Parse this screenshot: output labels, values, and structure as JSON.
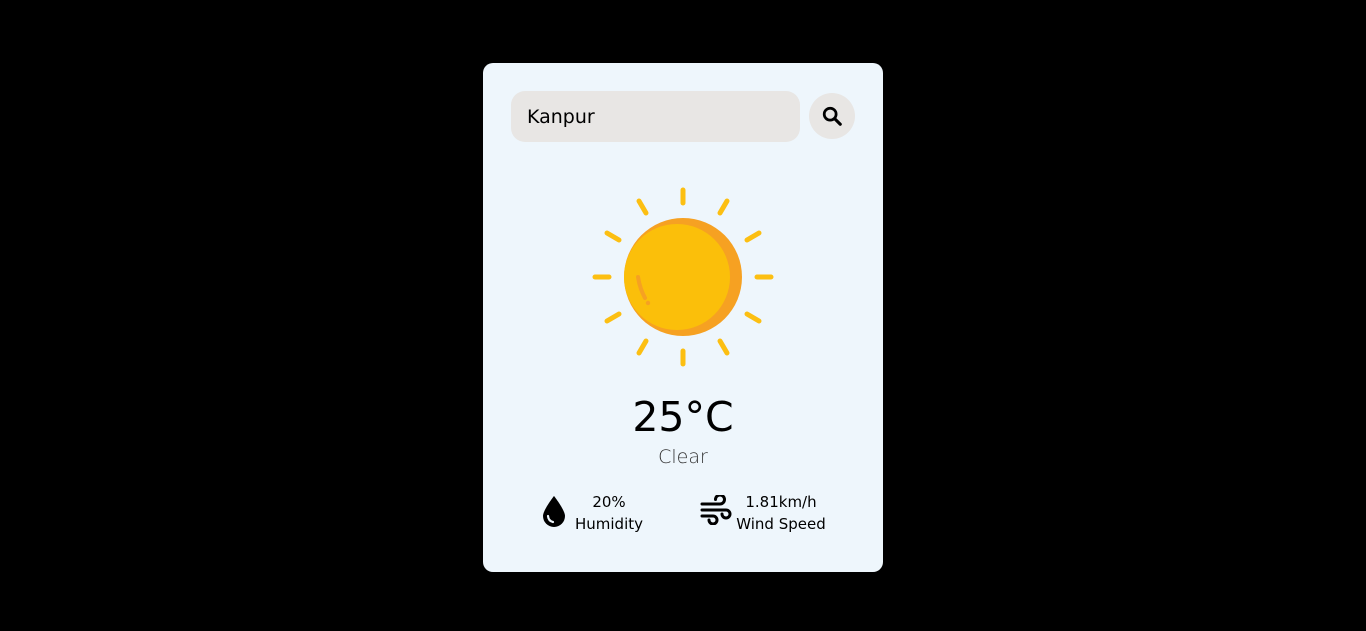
{
  "search": {
    "value": "Kanpur",
    "icon": "search-icon"
  },
  "weather": {
    "icon": "sun-icon",
    "temperature": "25°C",
    "condition": "Clear"
  },
  "details": {
    "humidity": {
      "icon": "humidity-drop-icon",
      "value": "20%",
      "label": "Humidity"
    },
    "wind": {
      "icon": "wind-icon",
      "value": "1.81km/h",
      "label": "Wind Speed"
    }
  },
  "colors": {
    "page_background": "#000000",
    "card_background": "#eef6fc",
    "input_background": "#e8e6e4",
    "sun_yellow": "#fbbf0a",
    "sun_orange": "#f6a122",
    "ray_yellow": "#fcbf12"
  }
}
